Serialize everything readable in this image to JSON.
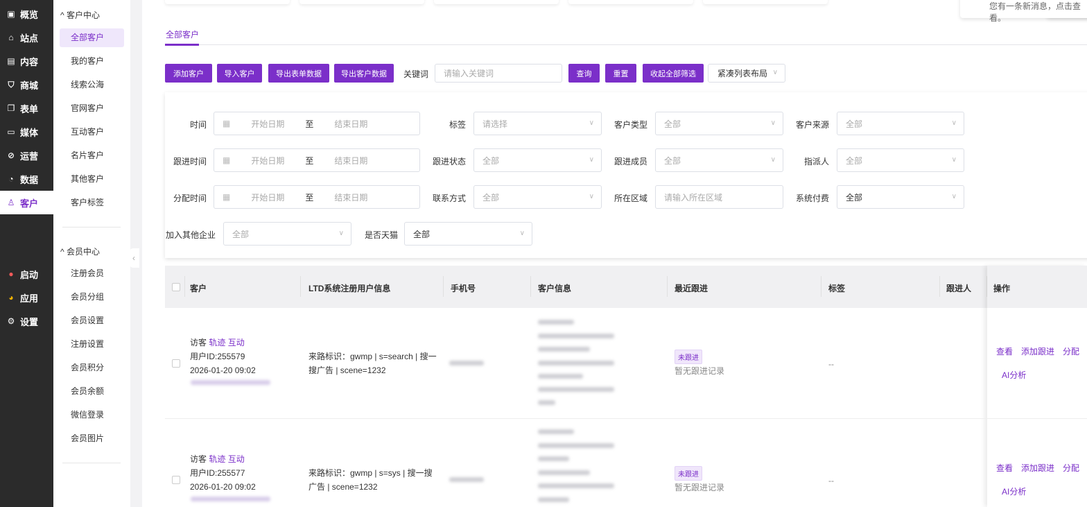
{
  "nav": {
    "items": [
      {
        "label": "概览",
        "icon": "dashboard-icon"
      },
      {
        "label": "站点",
        "icon": "home-icon"
      },
      {
        "label": "内容",
        "icon": "document-icon"
      },
      {
        "label": "商城",
        "icon": "cart-icon"
      },
      {
        "label": "表单",
        "icon": "form-icon"
      },
      {
        "label": "媒体",
        "icon": "media-icon"
      },
      {
        "label": "运营",
        "icon": "paperclip-icon"
      },
      {
        "label": "数据",
        "icon": "pie-chart-icon"
      },
      {
        "label": "客户",
        "icon": "user-icon"
      }
    ],
    "bottom": [
      {
        "label": "启动",
        "icon": "launch-icon"
      },
      {
        "label": "应用",
        "icon": "apps-icon"
      },
      {
        "label": "设置",
        "icon": "gear-icon"
      }
    ]
  },
  "submenu": {
    "customer_center": "客户中心",
    "customer_items": [
      "全部客户",
      "我的客户",
      "线索公海",
      "官网客户",
      "互动客户",
      "名片客户",
      "其他客户",
      "客户标签"
    ],
    "member_center": "会员中心",
    "member_items": [
      "注册会员",
      "会员分组",
      "会员设置",
      "注册设置",
      "会员积分",
      "会员余额",
      "微信登录",
      "会员图片"
    ]
  },
  "notice": "您有一条新消息，点击查看。",
  "tab": "全部客户",
  "toolbar": {
    "add": "添加客户",
    "import": "导入客户",
    "export_form": "导出表单数据",
    "export_customer": "导出客户数据",
    "keyword_label": "关键词",
    "keyword_placeholder": "请输入关键词",
    "query": "查询",
    "reset": "重置",
    "collapse": "收起全部筛选",
    "layout": "紧凑列表布局"
  },
  "filters": {
    "start": "开始日期",
    "to": "至",
    "end": "结束日期",
    "time": "时间",
    "follow_time": "跟进时间",
    "assign_time": "分配时间",
    "tag": "标签",
    "tag_ph": "请选择",
    "follow_status": "跟进状态",
    "contact": "联系方式",
    "type": "客户类型",
    "member": "跟进成员",
    "region": "所在区域",
    "region_ph": "请输入所在区域",
    "source": "客户来源",
    "assignee": "指派人",
    "paid": "系统付费",
    "other_ent": "加入其他企业",
    "tmall": "是否天猫",
    "all": "全部"
  },
  "table": {
    "headers": [
      "客户",
      "LTD系统注册用户信息",
      "手机号",
      "客户信息",
      "最近跟进",
      "标签",
      "跟进人",
      "操作"
    ],
    "rows": [
      {
        "type": "访客",
        "track": "轨迹",
        "interact": "互动",
        "uid": "用户ID:255579",
        "time": "2026-01-20 09:02",
        "source": "来路标识：gwmp | s=search | 搜一搜广告 | scene=1232",
        "status": "未跟进",
        "follow": "暂无跟进记录",
        "tag": "--",
        "ops": [
          "查看",
          "添加跟进",
          "分配",
          "AI分析"
        ]
      },
      {
        "type": "访客",
        "track": "轨迹",
        "interact": "互动",
        "uid": "用户ID:255577",
        "time": "2026-01-20 09:02",
        "source": "来路标识：gwmp | s=sys | 搜一搜广告 | scene=1232",
        "status": "未跟进",
        "follow": "暂无跟进记录",
        "tag": "--",
        "ops": [
          "查看",
          "添加跟进",
          "分配",
          "AI分析"
        ]
      }
    ]
  }
}
